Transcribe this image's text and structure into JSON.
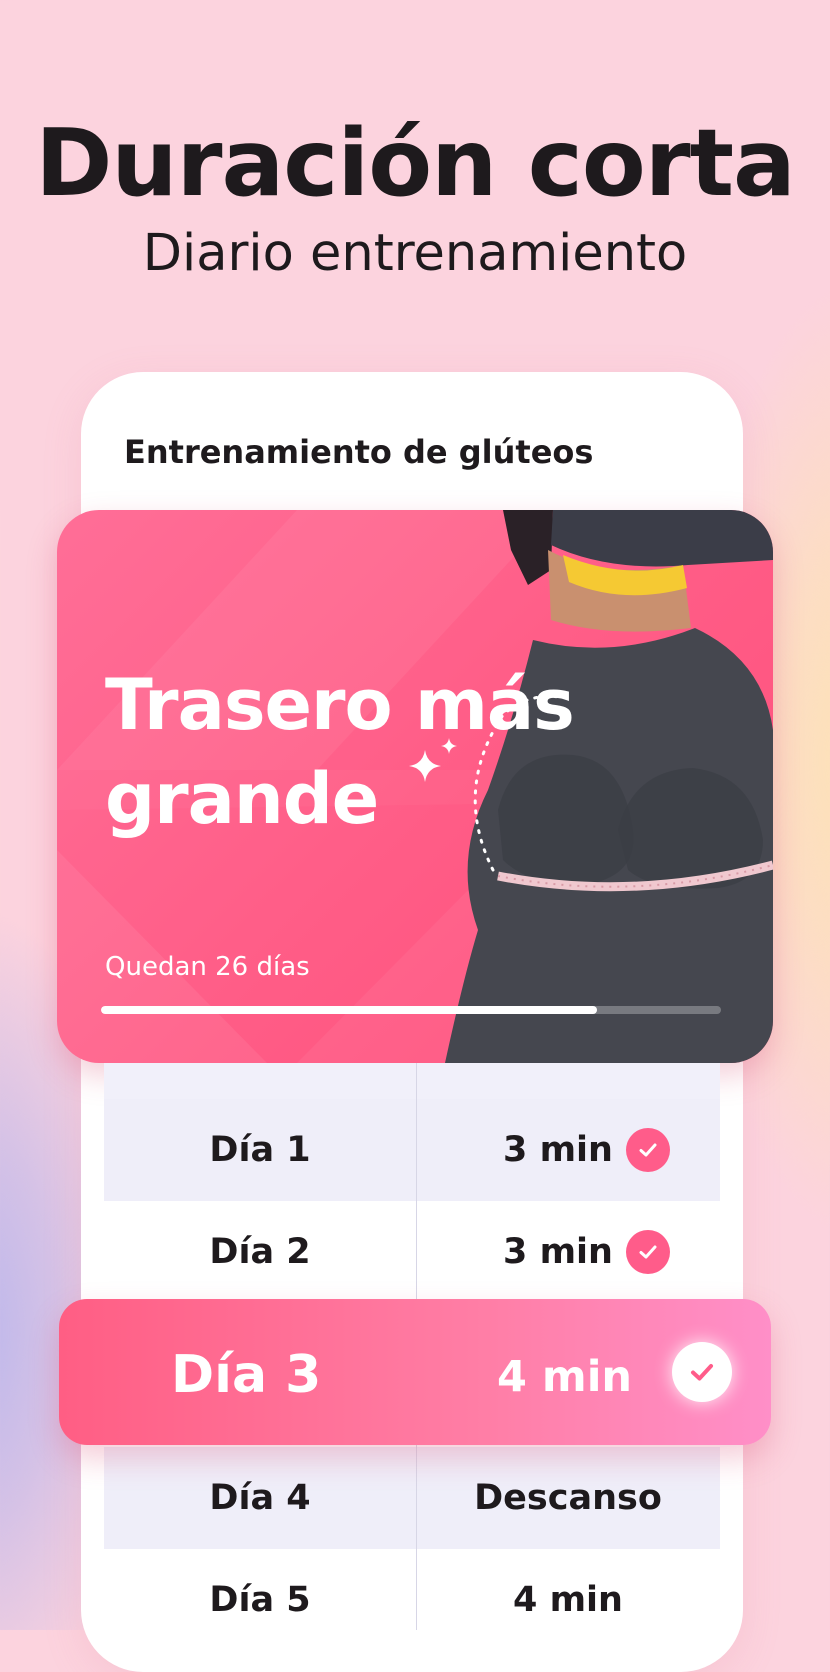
{
  "headline": {
    "title": "Duración corta",
    "subtitle": "Diario entrenamiento"
  },
  "phone": {
    "title": "Entrenamiento de glúteos"
  },
  "hero": {
    "title": "Trasero más grande",
    "remaining": "Quedan 26 días",
    "progress": 0.8
  },
  "schedule": {
    "rows": [
      {
        "day": "Día 1",
        "duration": "3 min",
        "completed": true
      },
      {
        "day": "Día 2",
        "duration": "3 min",
        "completed": true
      },
      {
        "day": "Día 3",
        "duration": "4 min",
        "completed": true,
        "current": true
      },
      {
        "day": "Día 4",
        "duration": "Descanso",
        "completed": false
      },
      {
        "day": "Día 5",
        "duration": "4 min",
        "completed": false
      }
    ]
  },
  "icons": {
    "check": "check-icon",
    "sparkle": "sparkle-icon"
  },
  "colors": {
    "background": "#fcd3de",
    "accent": "#ff5c8a",
    "hero": "#ff5c86",
    "text": "#1e1a1d",
    "row_shade": "#efeef9"
  }
}
